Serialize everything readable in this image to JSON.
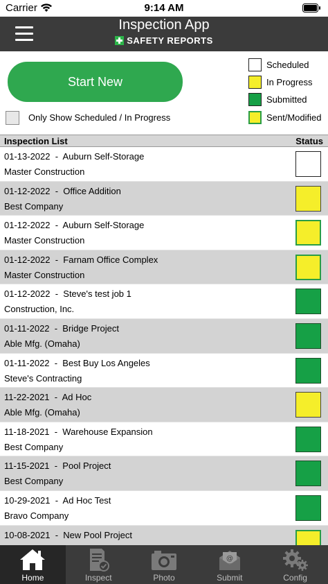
{
  "status_bar": {
    "carrier": "Carrier",
    "time": "9:14 AM"
  },
  "header": {
    "title": "Inspection App",
    "brand": "SAFETY REPORTS"
  },
  "start_button": {
    "label": "Start New"
  },
  "filter": {
    "label": "Only Show Scheduled / In Progress",
    "checked": false
  },
  "legend": [
    {
      "label": "Scheduled",
      "color": "#ffffff"
    },
    {
      "label": "In Progress",
      "color": "#f5ee2a"
    },
    {
      "label": "Submitted",
      "color": "#16a046"
    },
    {
      "label": "Sent/Modified",
      "color": "#f5ee2a",
      "border": "#2a9d46"
    }
  ],
  "list": {
    "header_left": "Inspection List",
    "header_right": "Status",
    "rows": [
      {
        "line1": "01-13-2022  -  Auburn Self-Storage",
        "line2": "Master Construction",
        "status": "Scheduled"
      },
      {
        "line1": "01-12-2022  -  Office Addition",
        "line2": "Best Company",
        "status": "In Progress"
      },
      {
        "line1": "01-12-2022  -  Auburn Self-Storage",
        "line2": "Master Construction",
        "status": "Sent/Modified"
      },
      {
        "line1": "01-12-2022  -  Farnam Office Complex",
        "line2": "Master Construction",
        "status": "Sent/Modified"
      },
      {
        "line1": "01-12-2022  -  Steve's test job 1",
        "line2": "Construction, Inc.",
        "status": "Submitted"
      },
      {
        "line1": "01-11-2022  -  Bridge Project",
        "line2": "Able Mfg. (Omaha)",
        "status": "Submitted"
      },
      {
        "line1": "01-11-2022  -  Best Buy Los Angeles",
        "line2": "Steve's Contracting",
        "status": "Submitted"
      },
      {
        "line1": "11-22-2021  -  Ad Hoc",
        "line2": "Able Mfg. (Omaha)",
        "status": "In Progress"
      },
      {
        "line1": "11-18-2021  -  Warehouse Expansion",
        "line2": "Best Company",
        "status": "Submitted"
      },
      {
        "line1": "11-15-2021  -  Pool Project",
        "line2": "Best Company",
        "status": "Submitted"
      },
      {
        "line1": "10-29-2021  -  Ad Hoc Test",
        "line2": "Bravo Company",
        "status": "Submitted"
      },
      {
        "line1": "10-08-2021  -  New Pool Project",
        "line2": "",
        "status": "Sent/Modified"
      }
    ]
  },
  "tabs": [
    {
      "label": "Home",
      "icon": "home-icon",
      "active": true
    },
    {
      "label": "Inspect",
      "icon": "clipboard-check-icon",
      "active": false
    },
    {
      "label": "Photo",
      "icon": "camera-icon",
      "active": false
    },
    {
      "label": "Submit",
      "icon": "mail-submit-icon",
      "active": false
    },
    {
      "label": "Config",
      "icon": "gears-icon",
      "active": false
    }
  ]
}
